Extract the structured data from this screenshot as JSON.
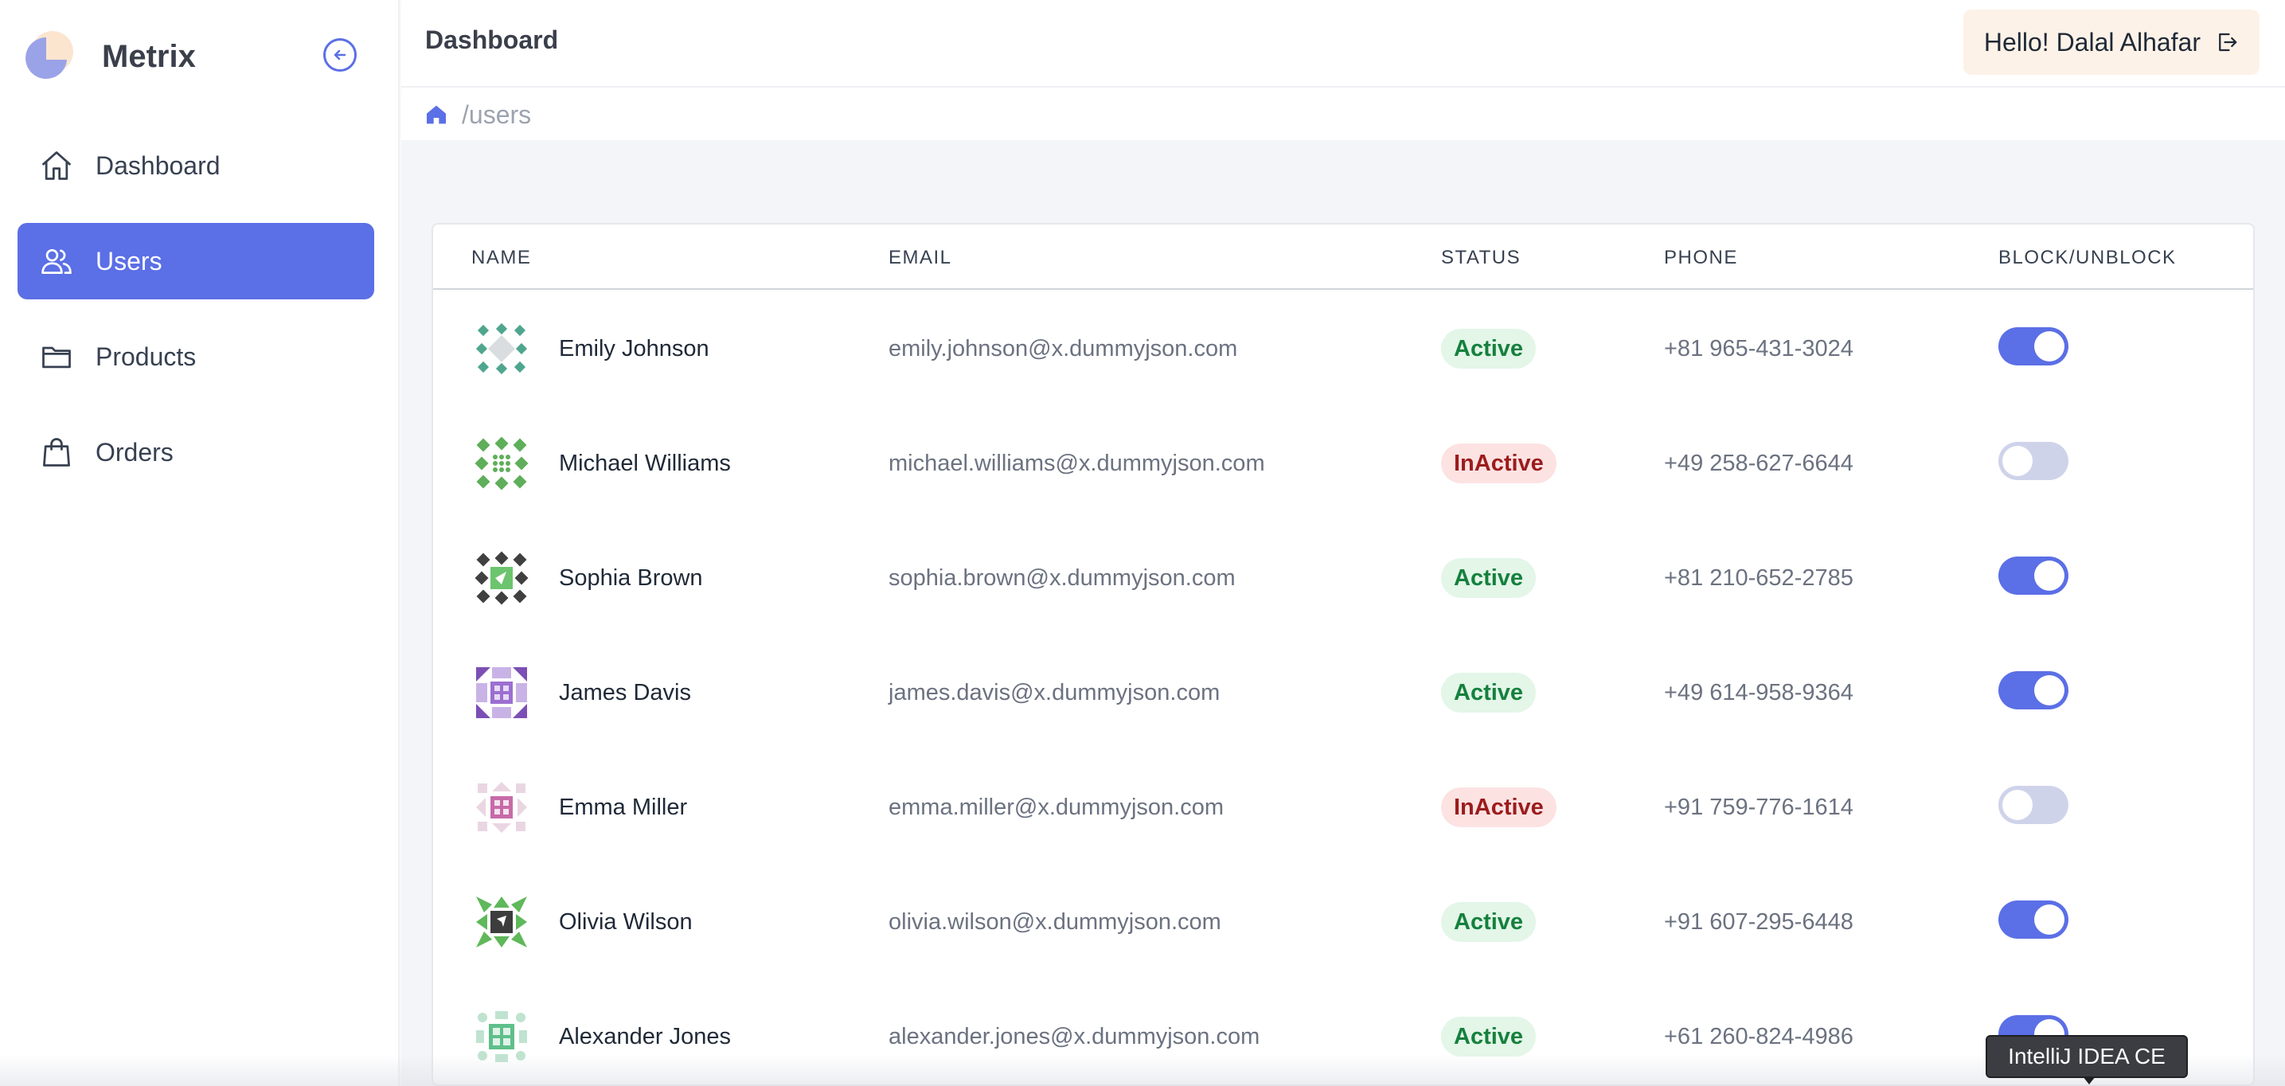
{
  "app": {
    "name": "Metrix"
  },
  "colors": {
    "accent": "#5b6fe6",
    "active_badge": "#15803d",
    "inactive_badge": "#9b1c1c",
    "user_chip_bg": "#fdf2e7"
  },
  "sidebar": {
    "collapse_icon": "arrow-left-circle-icon",
    "items": [
      {
        "label": "Dashboard",
        "icon": "home-icon",
        "active": false
      },
      {
        "label": "Users",
        "icon": "users-icon",
        "active": true
      },
      {
        "label": "Products",
        "icon": "folder-icon",
        "active": false
      },
      {
        "label": "Orders",
        "icon": "shopping-bag-icon",
        "active": false
      }
    ]
  },
  "header": {
    "title": "Dashboard",
    "greeting": "Hello! Dalal Alhafar",
    "logout_icon": "logout-icon"
  },
  "breadcrumb": {
    "home_icon": "home-icon",
    "path": "/users"
  },
  "table": {
    "columns": [
      "NAME",
      "EMAIL",
      "STATUS",
      "PHONE",
      "BLOCK/UNBLOCK"
    ],
    "rows": [
      {
        "name": "Emily Johnson",
        "email": "emily.johnson@x.dummyjson.com",
        "status": "Active",
        "phone": "+81 965-431-3024",
        "enabled": true
      },
      {
        "name": "Michael Williams",
        "email": "michael.williams@x.dummyjson.com",
        "status": "InActive",
        "phone": "+49 258-627-6644",
        "enabled": false
      },
      {
        "name": "Sophia Brown",
        "email": "sophia.brown@x.dummyjson.com",
        "status": "Active",
        "phone": "+81 210-652-2785",
        "enabled": true
      },
      {
        "name": "James Davis",
        "email": "james.davis@x.dummyjson.com",
        "status": "Active",
        "phone": "+49 614-958-9364",
        "enabled": true
      },
      {
        "name": "Emma Miller",
        "email": "emma.miller@x.dummyjson.com",
        "status": "InActive",
        "phone": "+91 759-776-1614",
        "enabled": false
      },
      {
        "name": "Olivia Wilson",
        "email": "olivia.wilson@x.dummyjson.com",
        "status": "Active",
        "phone": "+91 607-295-6448",
        "enabled": true
      },
      {
        "name": "Alexander Jones",
        "email": "alexander.jones@x.dummyjson.com",
        "status": "Active",
        "phone": "+61 260-824-4986",
        "enabled": true
      }
    ]
  },
  "tooltip": {
    "text": "IntelliJ IDEA CE"
  }
}
